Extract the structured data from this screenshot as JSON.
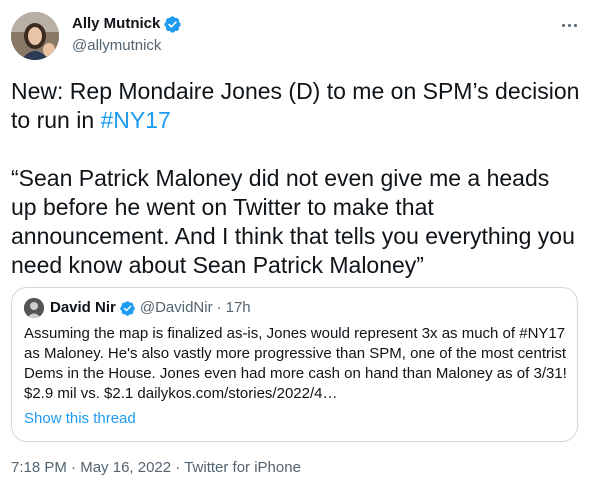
{
  "author": {
    "display_name": "Ally Mutnick",
    "handle": "@allymutnick"
  },
  "tweet": {
    "line1_text": "New: Rep Mondaire Jones (D) to me on SPM’s decision to run in ",
    "line1_hashtag": "#NY17",
    "quote_text": "“Sean Patrick Maloney did not even give me a heads up before he went on Twitter to make that announcement. And I think that tells you everything you need know about Sean Patrick Maloney”"
  },
  "quoted_tweet": {
    "display_name": "David Nir",
    "handle": "@DavidNir",
    "separator": "·",
    "time": "17h",
    "text": "Assuming the map is finalized as-is, Jones would represent 3x as much of #NY17 as Maloney. He's also vastly more progressive than SPM, one of the most centrist Dems in the House. Jones even had more cash on hand than Maloney as of 3/31! $2.9 mil vs. $2.1 dailykos.com/stories/2022/4…",
    "show_thread": "Show this thread"
  },
  "meta": {
    "time": "7:18 PM",
    "sep1": " · ",
    "date": "May 16, 2022",
    "sep2": " · ",
    "source": "Twitter for iPhone"
  },
  "colors": {
    "link": "#1d9bf0",
    "secondary_text": "#536471",
    "border": "#cfd9de"
  },
  "icons": {
    "verified": "verified-badge-icon",
    "more": "more-horizontal-icon"
  }
}
